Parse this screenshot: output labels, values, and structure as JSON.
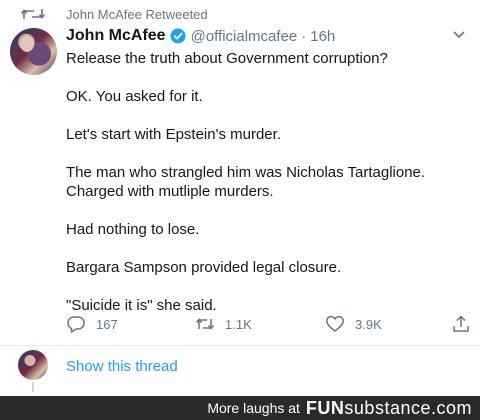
{
  "retweet": {
    "label": "John McAfee Retweeted",
    "icon": "retweet-icon"
  },
  "author": {
    "name": "John McAfee",
    "handle": "@officialmcafee",
    "separator": "·",
    "time": "16h",
    "verified": true,
    "verified_color": "#1da1f2"
  },
  "tweet": {
    "paragraphs": [
      "Release the truth about Government corruption?",
      "OK. You asked for it.",
      "Let's start with Epstein's murder.",
      "The man who strangled him was Nicholas Tartaglione. Charged with mutliple murders.",
      "Had nothing to lose.",
      "Bargara Sampson provided legal closure.",
      "\"Suicide it is\" she said."
    ]
  },
  "actions": {
    "reply": {
      "count": "167",
      "icon": "reply-icon"
    },
    "retweet": {
      "count": "1.1K",
      "icon": "retweet-icon"
    },
    "like": {
      "count": "3.9K",
      "icon": "heart-icon"
    },
    "share": {
      "icon": "share-icon"
    }
  },
  "thread": {
    "label": "Show this thread",
    "link_color": "#1da1f2"
  },
  "footer": {
    "tagline": "More laughs at",
    "brand_main": "FUN",
    "brand_sub": "substance",
    "brand_tld": ".com"
  }
}
